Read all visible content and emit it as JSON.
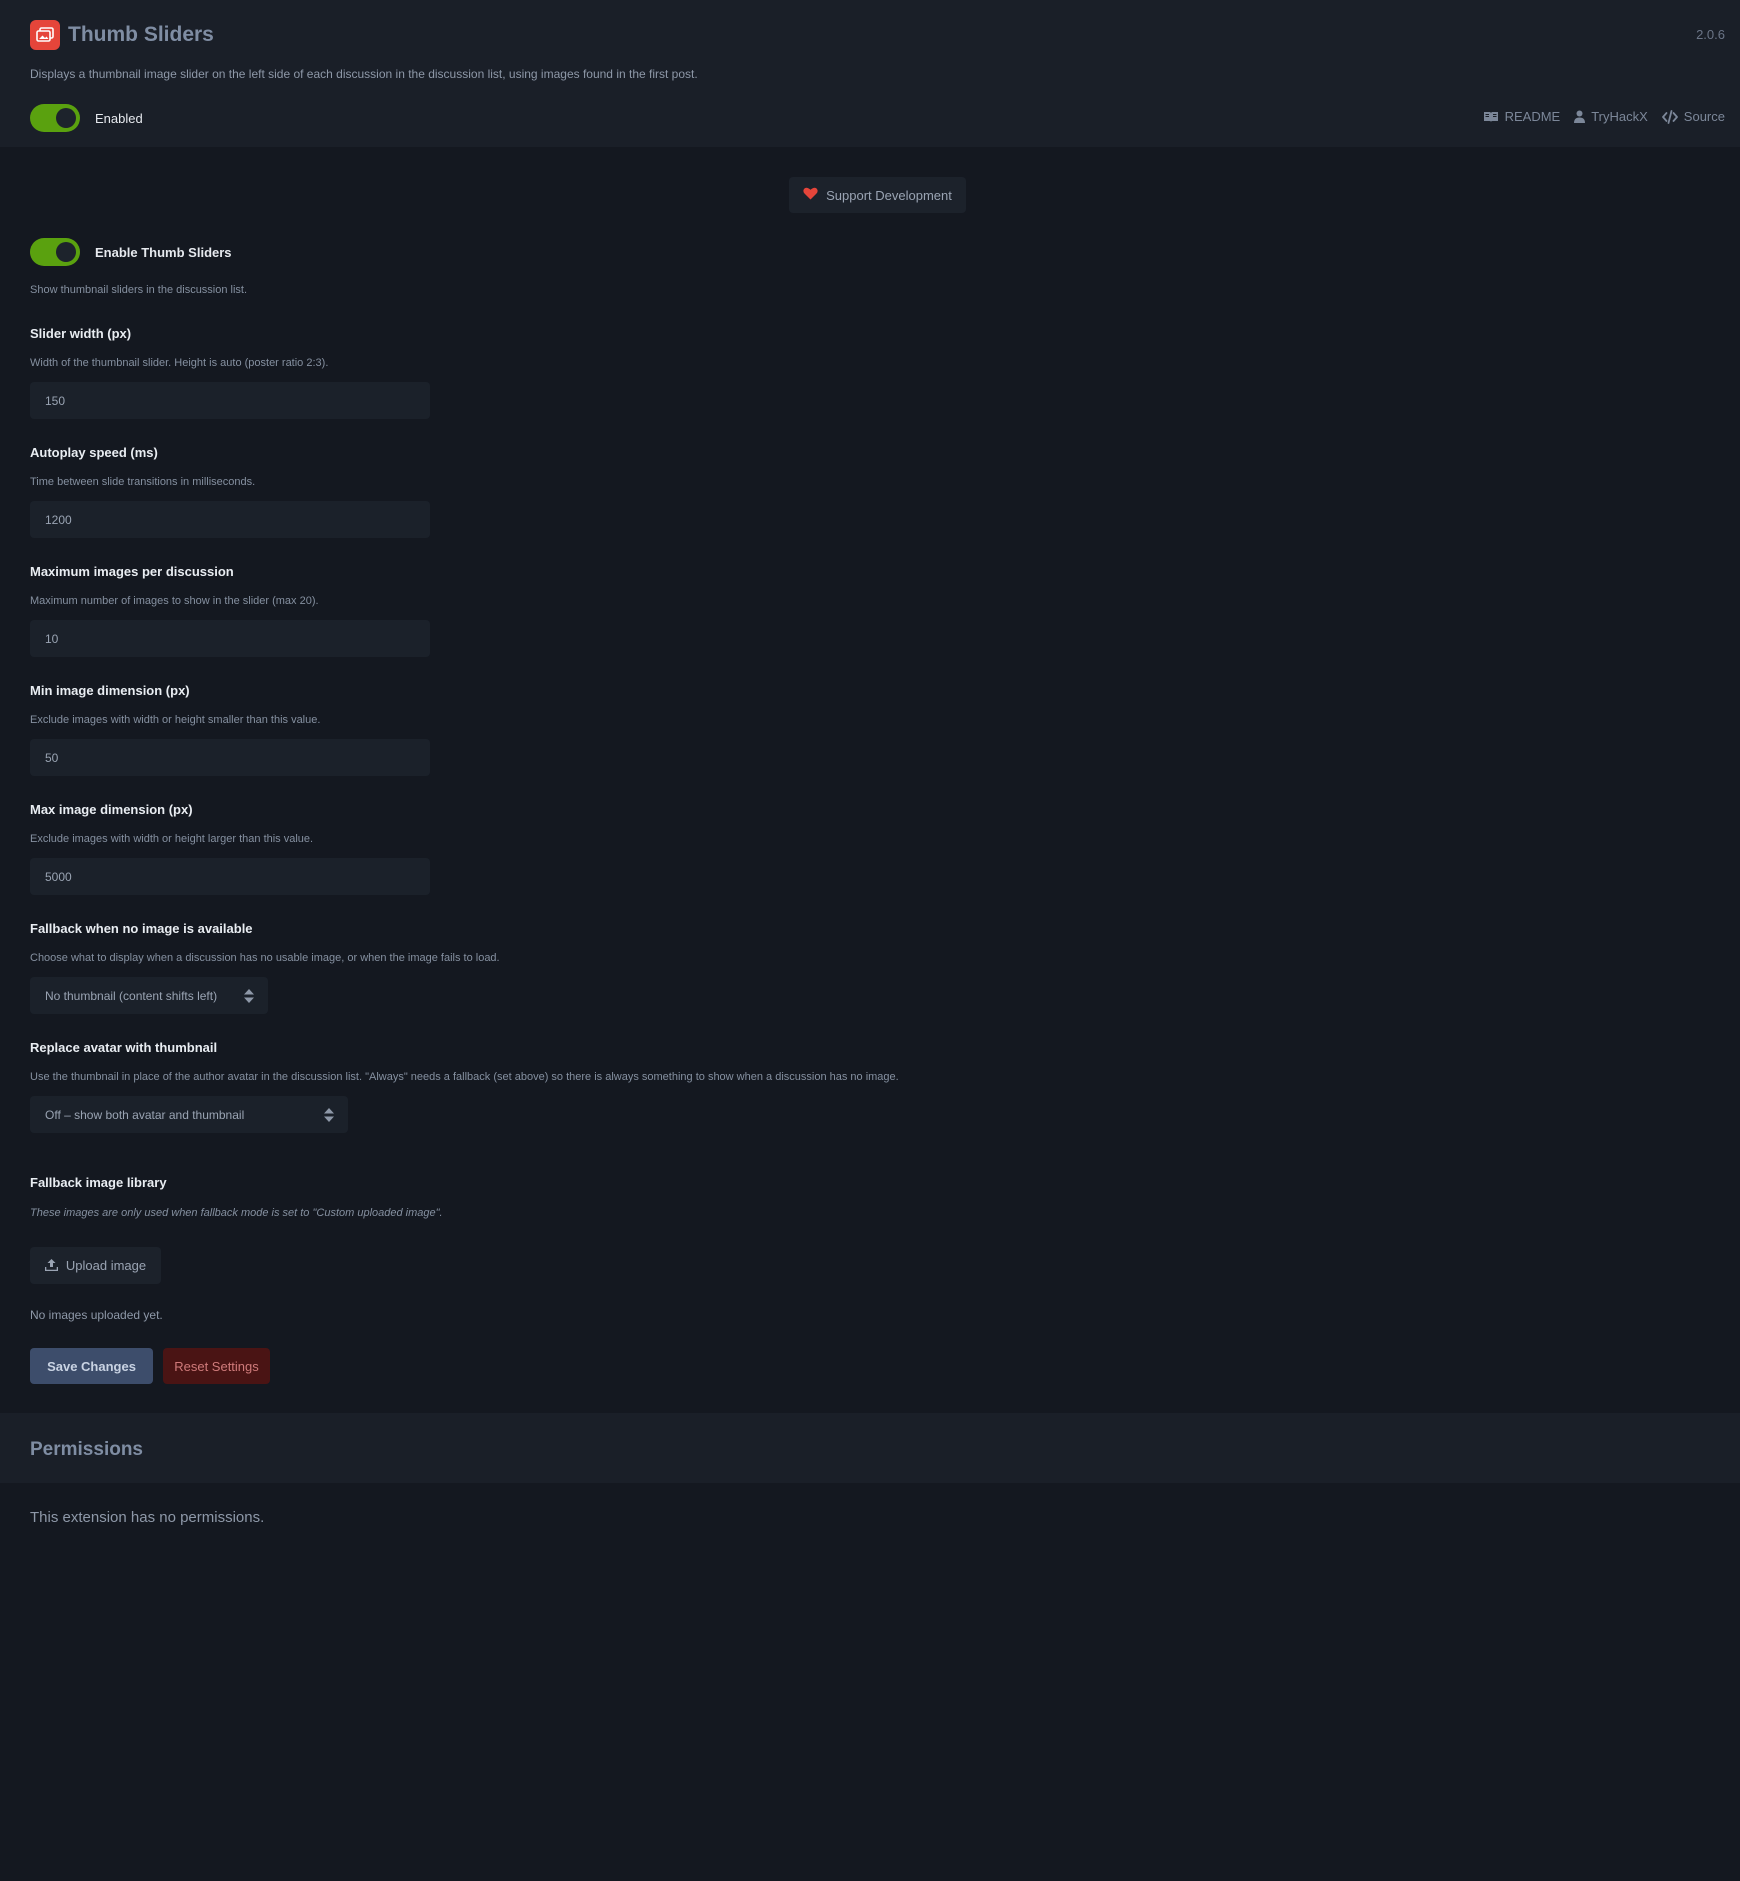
{
  "extension": {
    "title": "Thumb Sliders",
    "version": "2.0.6",
    "description": "Displays a thumbnail image slider on the left side of each discussion in the discussion list, using images found in the first post.",
    "enabled_label": "Enabled",
    "icon": "image-icon",
    "accent_color": "#e5453a"
  },
  "header_links": {
    "readme": "README",
    "author": "TryHackX",
    "source": "Source"
  },
  "support_label": "Support Development",
  "settings": {
    "enable": {
      "label": "Enable Thumb Sliders",
      "help": "Show thumbnail sliders in the discussion list.",
      "checked": true
    },
    "slider_width": {
      "label": "Slider width (px)",
      "help": "Width of the thumbnail slider. Height is auto (poster ratio 2:3).",
      "value": "150"
    },
    "autoplay_speed": {
      "label": "Autoplay speed (ms)",
      "help": "Time between slide transitions in milliseconds.",
      "value": "1200"
    },
    "max_images": {
      "label": "Maximum images per discussion",
      "help": "Maximum number of images to show in the slider (max 20).",
      "value": "10"
    },
    "min_dimension": {
      "label": "Min image dimension (px)",
      "help": "Exclude images with width or height smaller than this value.",
      "value": "50"
    },
    "max_dimension": {
      "label": "Max image dimension (px)",
      "help": "Exclude images with width or height larger than this value.",
      "value": "5000"
    },
    "fallback": {
      "label": "Fallback when no image is available",
      "help": "Choose what to display when a discussion has no usable image, or when the image fails to load.",
      "selected": "No thumbnail (content shifts left)"
    },
    "replace_avatar": {
      "label": "Replace avatar with thumbnail",
      "help": "Use the thumbnail in place of the author avatar in the discussion list. \"Always\" needs a fallback (set above) so there is always something to show when a discussion has no image.",
      "selected": "Off – show both avatar and thumbnail"
    },
    "library": {
      "label": "Fallback image library",
      "help": "These images are only used when fallback mode is set to \"Custom uploaded image\".",
      "upload_label": "Upload image",
      "empty_text": "No images uploaded yet."
    }
  },
  "actions": {
    "save": "Save Changes",
    "reset": "Reset Settings"
  },
  "permissions": {
    "title": "Permissions",
    "text": "This extension has no permissions."
  }
}
